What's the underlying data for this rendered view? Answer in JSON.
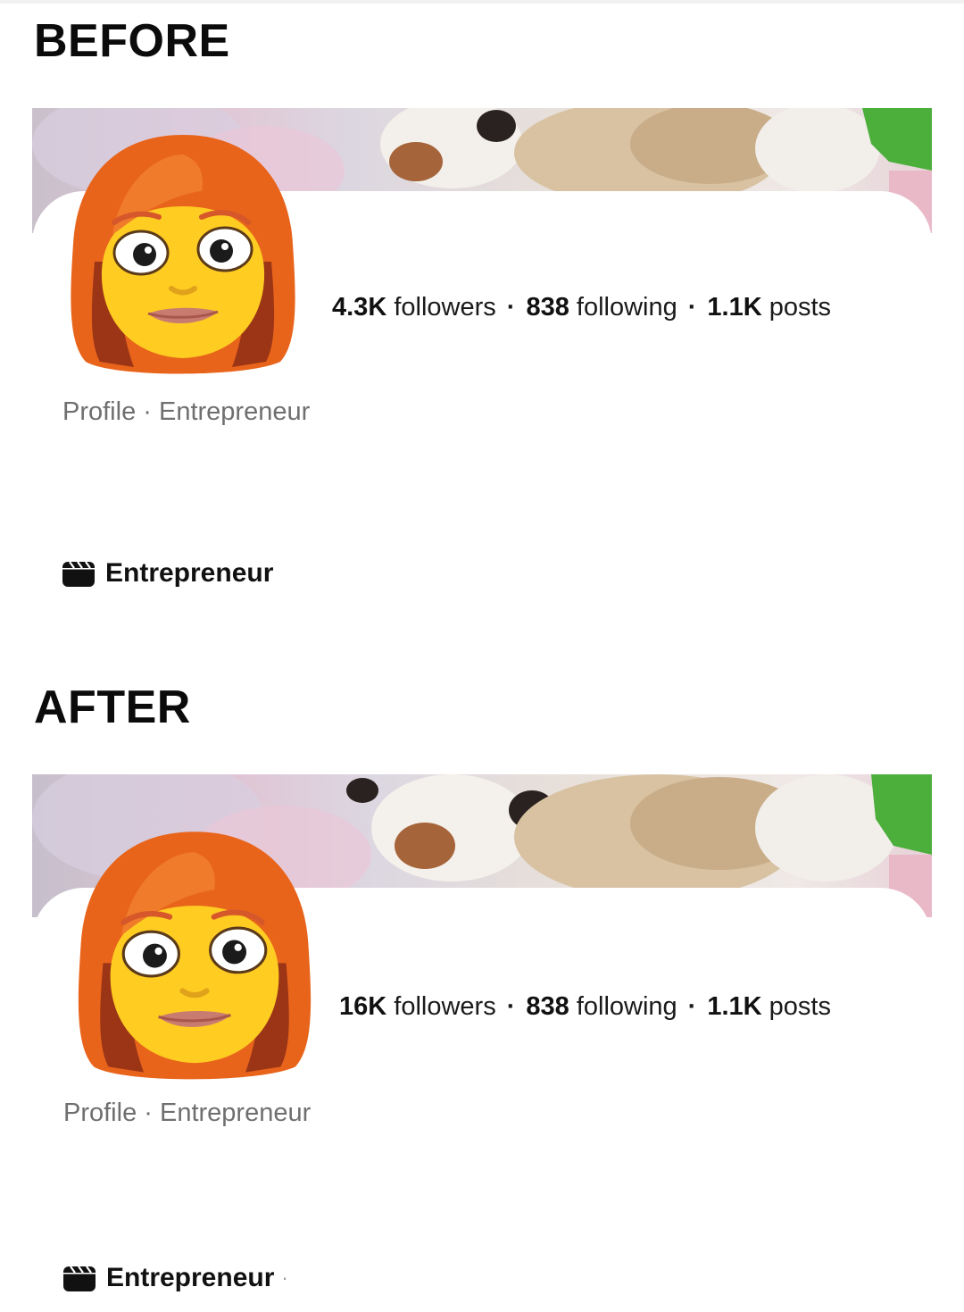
{
  "before": {
    "heading": "BEFORE",
    "stats": {
      "followers_value": "4.3K",
      "followers_label": "followers",
      "following_value": "838",
      "following_label": "following",
      "posts_value": "1.1K",
      "posts_label": "posts",
      "separator": "·"
    },
    "subtitle": "Profile · Entrepreneur",
    "category": "Entrepreneur",
    "category_icon": "clapperboard-icon"
  },
  "after": {
    "heading": "AFTER",
    "stats": {
      "followers_value": "16K",
      "followers_label": "followers",
      "following_value": "838",
      "following_label": "following",
      "posts_value": "1.1K",
      "posts_label": "posts",
      "separator": "·"
    },
    "subtitle": "Profile · Entrepreneur",
    "category": "Entrepreneur",
    "category_trailing": "·",
    "category_icon": "clapperboard-icon"
  },
  "avatar": {
    "icon": "woman-red-hair-emoji-avatar",
    "hair_color": "#E8641B",
    "skin_color": "#FFCC22"
  },
  "cover": {
    "icon": "cover-photo-dogs"
  }
}
